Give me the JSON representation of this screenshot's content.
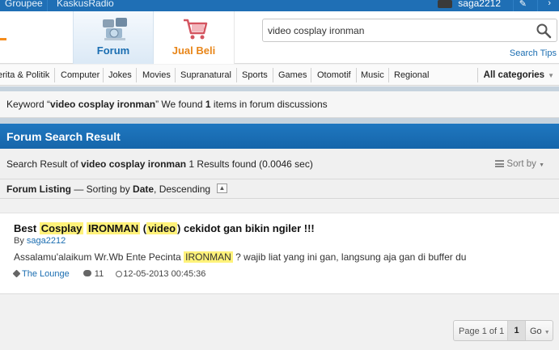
{
  "topbar": {
    "link1": "Groupee",
    "link2": "KaskusRadio",
    "username": "saga2212"
  },
  "nav": {
    "forum_label": "Forum",
    "jualbeli_label": "Jual Beli"
  },
  "search": {
    "value": "video cosplay ironman",
    "tips": "Search Tips"
  },
  "categories": [
    "erita & Politik",
    "Computer",
    "Jokes",
    "Movies",
    "Supranatural",
    "Sports",
    "Games",
    "Otomotif",
    "Music",
    "Regional"
  ],
  "all_categories": "All categories",
  "keyword_line": {
    "prefix": "Keyword “",
    "term": "video cosplay ironman",
    "middle": "” We found ",
    "count": "1",
    "suffix": " items in forum discussions"
  },
  "result": {
    "heading": "Forum Search Result",
    "summary_prefix": "Search Result of ",
    "summary_term": "video cosplay ironman",
    "summary_suffix": " 1 Results found (0.0046 sec)",
    "sort_by": "Sort by"
  },
  "listing": {
    "label": "Forum Listing",
    "dash": " — Sorting by ",
    "field": "Date",
    "order": ", Descending"
  },
  "thread": {
    "title_pre": "Best ",
    "hl1": "Cosplay",
    "hl2": "IRONMAN",
    "paren_open": " (",
    "hl3": "video",
    "title_post": ") cekidot gan bikin ngiler !!!",
    "by_label": "By ",
    "author": "saga2212",
    "excerpt_pre": "Assalamu'alaikum Wr.Wb Ente Pecinta ",
    "excerpt_hl": "IRONMAN",
    "excerpt_post": " ? wajib liat yang ini gan, langsung aja gan di buffer du",
    "forum": "The Lounge",
    "comments": "11",
    "date": "12-05-2013 00:45:36"
  },
  "pager": {
    "page_info": "Page 1 of 1",
    "current": "1",
    "go": "Go"
  },
  "colors": {
    "brand_blue": "#1f6fb5",
    "accent_orange": "#e8861a",
    "highlight": "#fff27a"
  }
}
